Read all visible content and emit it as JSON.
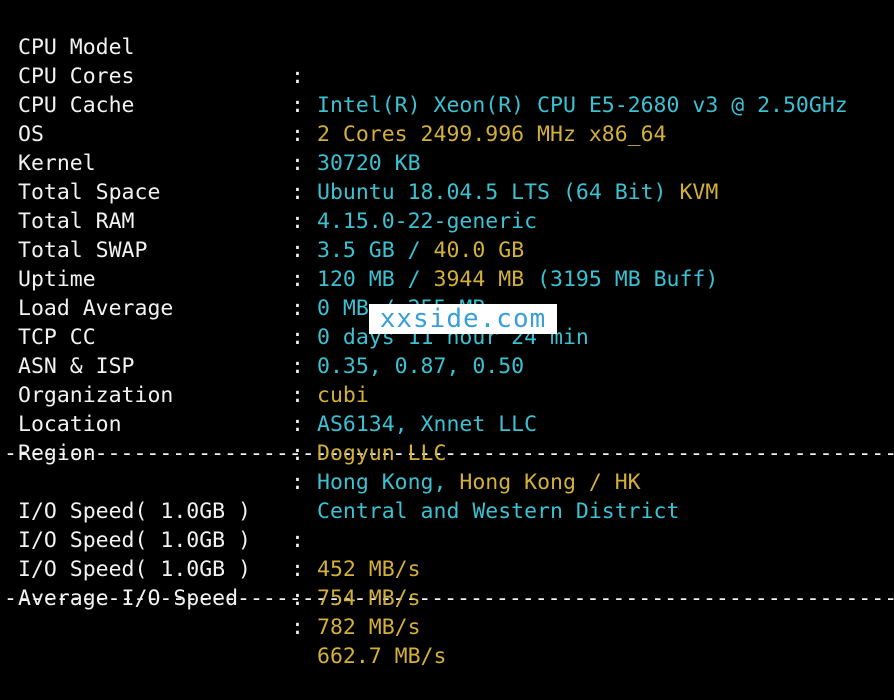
{
  "system_info": {
    "cpu_model": {
      "label": "CPU Model",
      "value": "Intel(R) Xeon(R) CPU E5-2680 v3 @ 2.50GHz"
    },
    "cpu_cores": {
      "label": "CPU Cores",
      "value": "2 Cores 2499.996 MHz x86_64"
    },
    "cpu_cache": {
      "label": "CPU Cache",
      "value": "30720 KB"
    },
    "os": {
      "label": "OS",
      "value_main": "Ubuntu 18.04.5 LTS (64 Bit)",
      "value_virt": "KVM"
    },
    "kernel": {
      "label": "Kernel",
      "value": "4.15.0-22-generic"
    },
    "total_space": {
      "label": "Total Space",
      "used": "3.5 GB",
      "slash": "/",
      "total": "40.0 GB"
    },
    "total_ram": {
      "label": "Total RAM",
      "used": "120 MB",
      "slash": "/",
      "total": "3944 MB",
      "buff": "(3195 MB Buff)"
    },
    "total_swap": {
      "label": "Total SWAP",
      "value": "0 MB / 255 MB"
    },
    "uptime": {
      "label": "Uptime",
      "value": "0 days 11 hour 24 min"
    },
    "load_average": {
      "label": "Load Average",
      "value": "0.35, 0.87, 0.50"
    },
    "tcp_cc": {
      "label": "TCP CC",
      "value": "cubi"
    },
    "asn_isp": {
      "label": "ASN & ISP",
      "value": "AS6134, Xnnet LLC"
    },
    "organization": {
      "label": "Organization",
      "value": "Dogyun LLC"
    },
    "location": {
      "label": "Location",
      "country": "Hong Kong,",
      "city": "Hong Kong / HK"
    },
    "region": {
      "label": "Region",
      "value": "Central and Western District"
    }
  },
  "io": {
    "run1": {
      "label": "I/O Speed( 1.0GB )",
      "value": "452 MB/s"
    },
    "run2": {
      "label": "I/O Speed( 1.0GB )",
      "value": "754 MB/s"
    },
    "run3": {
      "label": "I/O Speed( 1.0GB )",
      "value": "782 MB/s"
    },
    "average": {
      "label": "Average I/O Speed",
      "value": "662.7 MB/s"
    }
  },
  "separator": ":",
  "divider": "----------------------------------------------------------------------",
  "watermark": "xxside.com",
  "colors": {
    "background": "#000000",
    "label": "#f2f2f2",
    "cyan": "#3bc1d2",
    "yellow": "#d2b039",
    "watermark_text": "#3a9fd8"
  }
}
